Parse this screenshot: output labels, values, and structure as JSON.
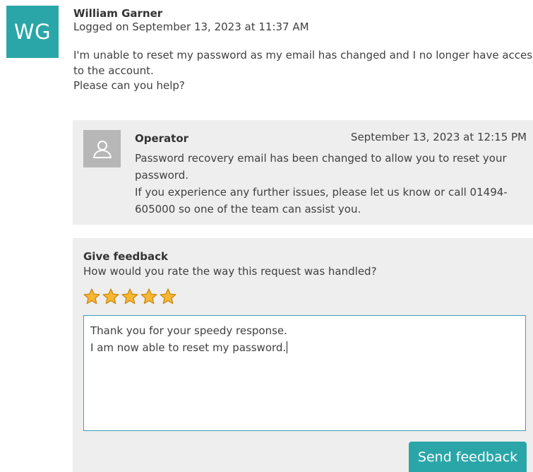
{
  "ticket": {
    "avatar_initials": "WG",
    "author_name": "William Garner",
    "logged_text": "Logged on September 13, 2023 at 11:37 AM",
    "message_lines": [
      "I'm unable to reset my password as my email has changed and I no longer have access",
      "to the account.",
      "Please can you help?"
    ]
  },
  "reply": {
    "author": "Operator",
    "timestamp": "September 13, 2023 at 12:15 PM",
    "lines": [
      "Password recovery email has been changed to allow you to reset your",
      "password.",
      "If you experience any further issues, please let us know or call 01494-",
      "605000 so one of the team can assist you."
    ],
    "avatar_icon": "user-icon"
  },
  "feedback": {
    "heading": "Give feedback",
    "question": "How would you rate the way this request was handled?",
    "rating": 5,
    "rating_max": 5,
    "text_lines": [
      "Thank you for your speedy response.",
      "I am now able to reset my password."
    ],
    "send_label": "Send feedback"
  },
  "colors": {
    "accent": "#2aa6a8",
    "panel_bg": "#eeeeee",
    "star_fill": "#f7b631",
    "star_stroke": "#c98a14"
  }
}
